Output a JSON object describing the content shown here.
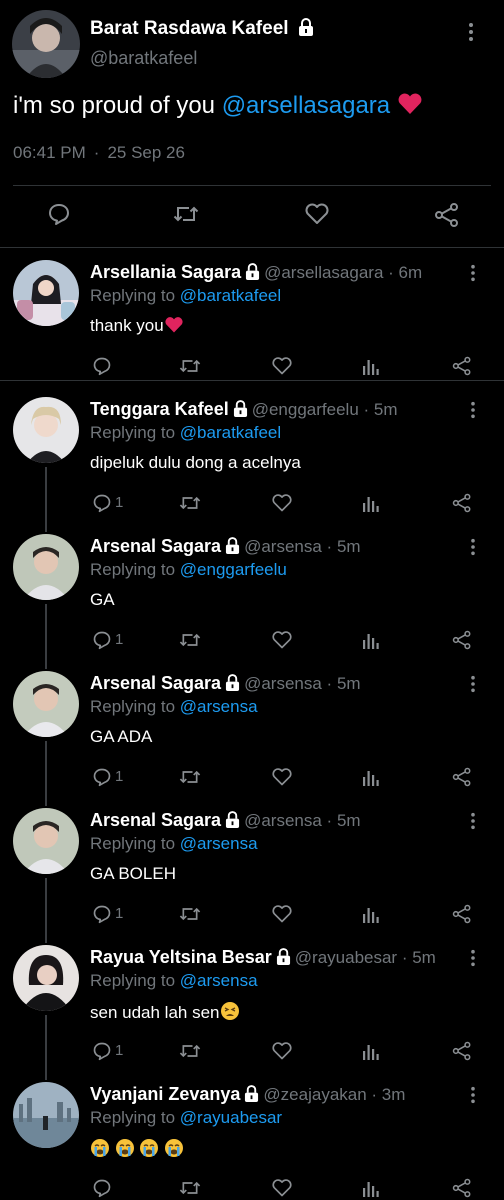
{
  "main_tweet": {
    "name": "Barat Rasdawa Kafeel",
    "handle": "@baratkafeel",
    "text_prefix": "i'm so proud of you ",
    "mention": "@arsellasagara",
    "time": "06:41 PM",
    "date": "25 Sep 26"
  },
  "replies": [
    {
      "name": "Arsellania Sagara",
      "handle": "@arsellasagara",
      "time": "6m",
      "replying_label": "Replying to ",
      "replying_to": "@baratkafeel",
      "text": "thank you",
      "reply_count": ""
    },
    {
      "name": "Tenggara Kafeel",
      "handle": "@enggarfeelu",
      "time": "5m",
      "replying_label": "Replying to ",
      "replying_to": "@baratkafeel",
      "text": "dipeluk dulu dong a acelnya",
      "reply_count": "1"
    },
    {
      "name": "Arsenal Sagara",
      "handle": "@arsensa",
      "time": "5m",
      "replying_label": "Replying to ",
      "replying_to": "@enggarfeelu",
      "text": "GA",
      "reply_count": "1"
    },
    {
      "name": "Arsenal Sagara",
      "handle": "@arsensa",
      "time": "5m",
      "replying_label": "Replying to ",
      "replying_to": "@arsensa",
      "text": "GA ADA",
      "reply_count": "1"
    },
    {
      "name": "Arsenal Sagara",
      "handle": "@arsensa",
      "time": "5m",
      "replying_label": "Replying to ",
      "replying_to": "@arsensa",
      "text": "GA BOLEH",
      "reply_count": "1"
    },
    {
      "name": "Rayua Yeltsina Besar",
      "handle": "@rayuabesar",
      "time": "5m",
      "replying_label": "Replying to ",
      "replying_to": "@arsensa",
      "text": "sen udah lah sen",
      "reply_count": "1"
    },
    {
      "name": "Vyanjani Zevanya",
      "handle": "@zeajayakan",
      "time": "3m",
      "replying_label": "Replying to ",
      "replying_to": "@rayuabesar",
      "text": "",
      "reply_count": ""
    }
  ],
  "icons": {
    "actions": [
      "reply-icon",
      "retweet-icon",
      "like-icon",
      "analytics-icon",
      "share-icon"
    ],
    "more": "more-vertical-icon",
    "lock": "lock-icon",
    "heart_emoji": "red-heart-emoji",
    "tired_emoji": "tired-face-emoji",
    "crying_emoji": "loudly-crying-face-emoji"
  },
  "colors": {
    "background": "#000000",
    "mention": "#1d9bf0",
    "secondary_text": "#71767b",
    "heart": "#e0245e"
  }
}
